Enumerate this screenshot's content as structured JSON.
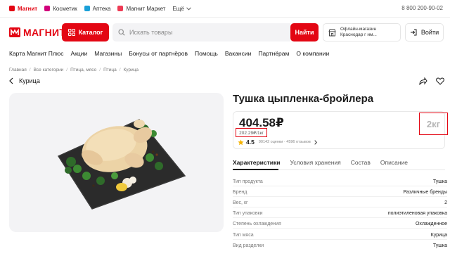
{
  "topbar": {
    "links": [
      {
        "label": "Магнит",
        "active": true,
        "color": "#e30613"
      },
      {
        "label": "Косметик",
        "active": false,
        "color": "#d1007b"
      },
      {
        "label": "Аптека",
        "active": false,
        "color": "#1aa0d8"
      },
      {
        "label": "Магнит Маркет",
        "active": false,
        "color": "#ee3a54"
      }
    ],
    "more": "Ещё",
    "phone": "8 800 200-90-02"
  },
  "header": {
    "logo_text": "МАГНИТ",
    "catalog_label": "Каталог",
    "search_placeholder": "Искать товары",
    "find_label": "Найти",
    "store_line1": "Офлайн-магазин",
    "store_line2": "Краснодар г им...",
    "login_label": "Войти"
  },
  "nav": [
    "Карта Магнит Плюс",
    "Акции",
    "Магазины",
    "Бонусы от партнёров",
    "Помощь",
    "Вакансии",
    "Партнёрам",
    "О компании"
  ],
  "breadcrumb": [
    "Главная",
    "Все категории",
    "Птица, мясо",
    "Птица",
    "Курица"
  ],
  "back_label": "Курица",
  "product": {
    "title": "Тушка цыпленка-бройлера",
    "price": "404.58₽",
    "price_per_kg": "202.29₽/1кг",
    "rating": "4.5",
    "rating_meta": "90142 оценки · 4596 отзывов",
    "weight": "2кг"
  },
  "tabs": [
    "Характеристики",
    "Условия хранения",
    "Состав",
    "Описание"
  ],
  "specs": [
    {
      "label": "Тип продукта",
      "value": "Тушка"
    },
    {
      "label": "Бренд",
      "value": "Различные бренды"
    },
    {
      "label": "Вес, кг",
      "value": "2"
    },
    {
      "label": "Тип упаковки",
      "value": "полиэтиленовая упаковка"
    },
    {
      "label": "Степень охлаждения",
      "value": "Охлажденное"
    },
    {
      "label": "Тип мяса",
      "value": "Курица"
    },
    {
      "label": "Вид разделки",
      "value": "Тушка"
    }
  ],
  "colors": {
    "accent": "#e30613",
    "star": "#f5b301"
  }
}
